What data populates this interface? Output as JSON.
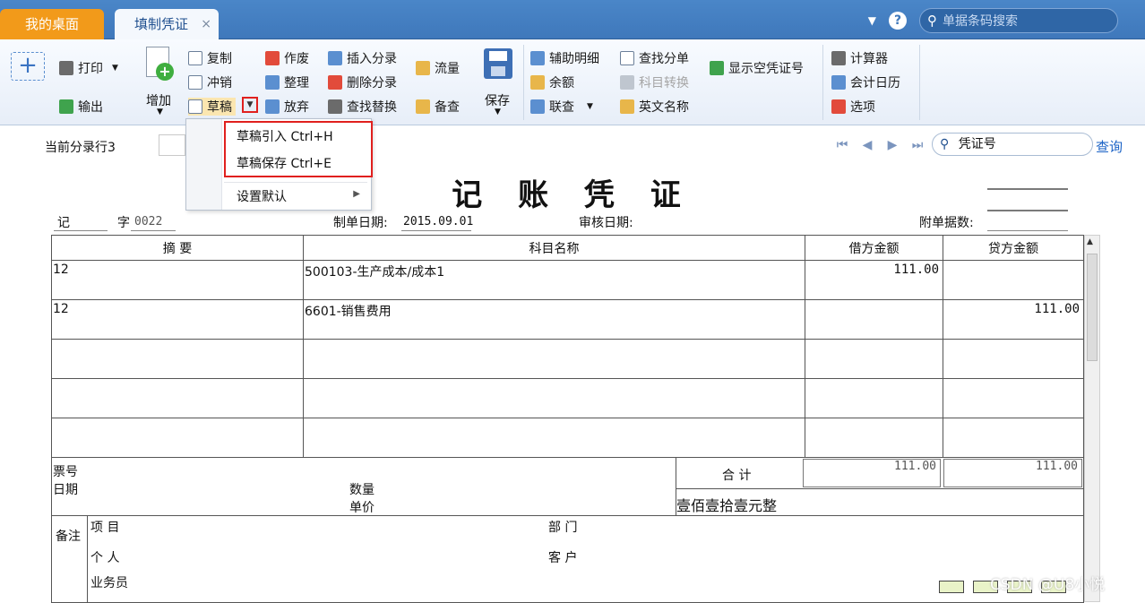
{
  "tabs": {
    "home": "我的桌面",
    "voucher": "填制凭证",
    "close": "×"
  },
  "search": {
    "placeholder": "单据条码搜索"
  },
  "ribbon": {
    "print": "打印",
    "export": "输出",
    "add": "增加",
    "copy": "复制",
    "reverse": "冲销",
    "draft": "草稿",
    "void": "作废",
    "organize": "整理",
    "abandon": "放弃",
    "insert_entry": "插入分录",
    "delete_entry": "删除分录",
    "find_replace": "查找替换",
    "cash_flow": "流量",
    "memo": "备查",
    "save": "保存",
    "aux_detail": "辅助明细",
    "balance": "余额",
    "linked_query": "联查",
    "find_entry": "查找分单",
    "account_convert": "科目转换",
    "english_name": "英文名称",
    "show_empty": "显示空凭证号",
    "calculator": "计算器",
    "calendar": "会计日历",
    "options": "选项"
  },
  "dropdown": {
    "import": "草稿引入 Ctrl+H",
    "save": "草稿保存 Ctrl+E",
    "set_default": "设置默认"
  },
  "form": {
    "current_row": "当前分录行3",
    "search_value": "凭证号",
    "query": "查询",
    "title": "记 账 凭 证",
    "type": "记",
    "zi": "字",
    "number": "0022",
    "date_label": "制单日期:",
    "date": "2015.09.01",
    "audit_label": "审核日期:",
    "attach_label": "附单据数:"
  },
  "table": {
    "headers": [
      "摘 要",
      "科目名称",
      "借方金额",
      "贷方金额"
    ],
    "rows": [
      [
        "12",
        "500103-生产成本/成本1",
        "111.00",
        ""
      ],
      [
        "12",
        "6601-销售费用",
        "",
        "111.00"
      ],
      [
        "",
        "",
        "",
        ""
      ],
      [
        "",
        "",
        "",
        ""
      ],
      [
        "",
        "",
        "",
        ""
      ]
    ]
  },
  "footer": {
    "ticket_no": "票号",
    "ticket_date": "日期",
    "qty": "数量",
    "unit_price": "单价",
    "total_label": "合 计",
    "total_debit": "111.00",
    "total_credit": "111.00",
    "amount_words": "壹佰壹拾壹元整",
    "remarks": "备注",
    "project": "项 目",
    "department": "部 门",
    "person": "个 人",
    "customer": "客 户",
    "salesman": "业务员"
  },
  "watermark": "CSDN @U8小悦"
}
